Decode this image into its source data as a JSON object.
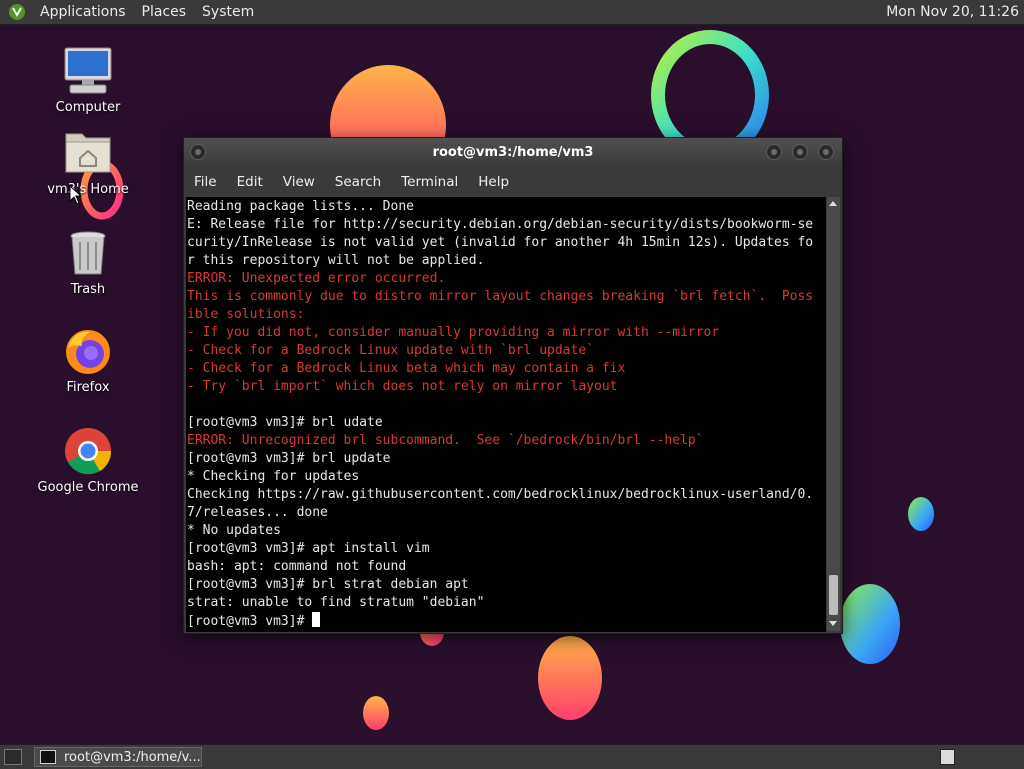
{
  "top_panel": {
    "menus": [
      "Applications",
      "Places",
      "System"
    ],
    "clock": "Mon Nov 20, 11:26",
    "logo_icon": "mate-logo-icon"
  },
  "desktop": {
    "icons": [
      {
        "label": "Computer",
        "icon": "computer-icon"
      },
      {
        "label": "vm3's Home",
        "icon": "home-folder-icon"
      },
      {
        "label": "Trash",
        "icon": "trash-icon"
      },
      {
        "label": "Firefox",
        "icon": "firefox-icon"
      },
      {
        "label": "Google Chrome",
        "icon": "chrome-icon"
      }
    ]
  },
  "terminal": {
    "title": "root@vm3:/home/vm3",
    "menu": [
      "File",
      "Edit",
      "View",
      "Search",
      "Terminal",
      "Help"
    ],
    "lines": [
      {
        "text": "Reading package lists... Done",
        "style": "normal"
      },
      {
        "text": "E: Release file for http://security.debian.org/debian-security/dists/bookworm-se",
        "style": "normal"
      },
      {
        "text": "curity/InRelease is not valid yet (invalid for another 4h 15min 12s). Updates fo",
        "style": "normal"
      },
      {
        "text": "r this repository will not be applied.",
        "style": "normal"
      },
      {
        "text": "ERROR: Unexpected error occurred.",
        "style": "error"
      },
      {
        "text": "This is commonly due to distro mirror layout changes breaking `brl fetch`.  Poss",
        "style": "error"
      },
      {
        "text": "ible solutions:",
        "style": "error"
      },
      {
        "text": "- If you did not, consider manually providing a mirror with --mirror",
        "style": "error"
      },
      {
        "text": "- Check for a Bedrock Linux update with `brl update`",
        "style": "error"
      },
      {
        "text": "- Check for a Bedrock Linux beta which may contain a fix",
        "style": "error"
      },
      {
        "text": "- Try `brl import` which does not rely on mirror layout",
        "style": "error"
      },
      {
        "text": "",
        "style": "normal"
      },
      {
        "text": "[root@vm3 vm3]# brl udate",
        "style": "normal"
      },
      {
        "text": "ERROR: Unrecognized brl subcommand.  See `/bedrock/bin/brl --help`",
        "style": "error"
      },
      {
        "text": "[root@vm3 vm3]# brl update",
        "style": "normal"
      },
      {
        "text": "* Checking for updates",
        "style": "normal"
      },
      {
        "text": "Checking https://raw.githubusercontent.com/bedrocklinux/bedrocklinux-userland/0.",
        "style": "normal"
      },
      {
        "text": "7/releases... done",
        "style": "normal"
      },
      {
        "text": "* No updates",
        "style": "normal"
      },
      {
        "text": "[root@vm3 vm3]# apt install vim",
        "style": "normal"
      },
      {
        "text": "bash: apt: command not found",
        "style": "normal"
      },
      {
        "text": "[root@vm3 vm3]# brl strat debian apt",
        "style": "normal"
      },
      {
        "text": "strat: unable to find stratum \"debian\"",
        "style": "normal"
      },
      {
        "text": "[root@vm3 vm3]# ",
        "style": "prompt"
      }
    ],
    "colors": {
      "error": "#d93838",
      "text": "#e8e8e8",
      "background": "#000000"
    }
  },
  "taskbar": {
    "tasks": [
      {
        "label": "root@vm3:/home/v...",
        "icon": "terminal-icon"
      }
    ]
  }
}
